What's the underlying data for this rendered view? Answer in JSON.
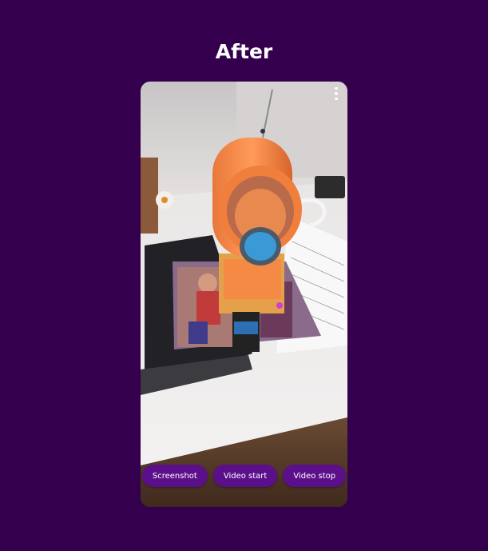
{
  "page": {
    "heading": "After"
  },
  "camera_view": {
    "menu_icon": "more-vert-icon"
  },
  "controls": {
    "screenshot_label": "Screenshot",
    "video_start_label": "Video start",
    "video_stop_label": "Video stop"
  },
  "colors": {
    "background": "#34004e",
    "button": "#5c0f8a",
    "button_text": "#ffffff",
    "heading_text": "#ffffff"
  }
}
